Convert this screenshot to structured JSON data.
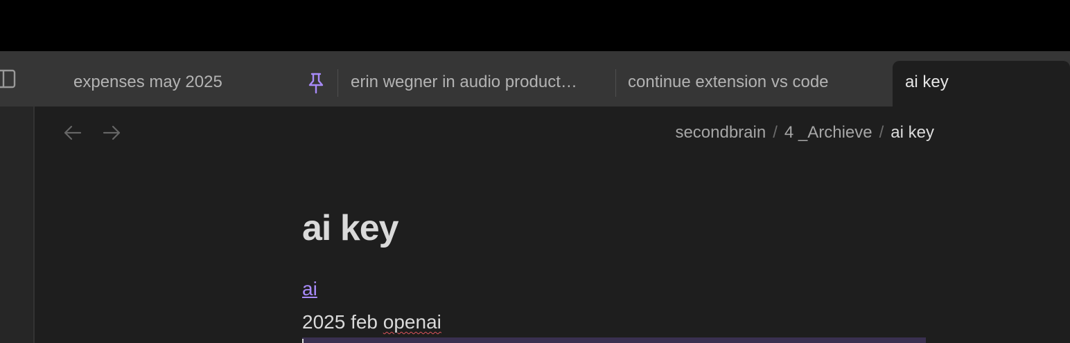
{
  "tabs": [
    {
      "label": "expenses may 2025",
      "active": false,
      "pinned": false
    },
    {
      "label": "erin wegner in audio product…",
      "active": false,
      "pinned": true
    },
    {
      "label": "continue extension vs code",
      "active": false,
      "pinned": false
    },
    {
      "label": "ai key",
      "active": true,
      "pinned": false
    }
  ],
  "breadcrumb": {
    "items": [
      "secondbrain",
      "4 _Archieve",
      "ai key"
    ],
    "separator": "/"
  },
  "note": {
    "title": "ai key",
    "link_text": "ai",
    "line_prefix": "2025 feb ",
    "line_misspelled": "openai"
  },
  "icons": {
    "sidebar_toggle": "sidebar-toggle-icon",
    "pin": "pin-icon",
    "back": "arrow-left-icon",
    "forward": "arrow-right-icon"
  },
  "colors": {
    "accent": "#a88bfa",
    "background": "#1e1e1e",
    "tabbar": "#363636"
  }
}
